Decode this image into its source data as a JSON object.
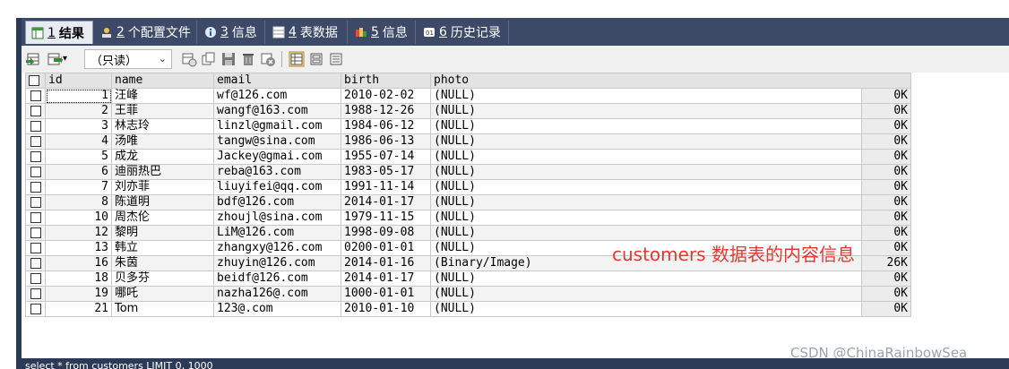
{
  "tabs": [
    {
      "num": "1",
      "label": "结果",
      "active": true,
      "icon": "result-grid-icon"
    },
    {
      "num": "2",
      "label": "个配置文件",
      "active": false,
      "icon": "profile-icon"
    },
    {
      "num": "3",
      "label": "信息",
      "active": false,
      "icon": "info-icon"
    },
    {
      "num": "4",
      "label": "表数据",
      "active": false,
      "icon": "table-data-icon"
    },
    {
      "num": "5",
      "label": "信息",
      "active": false,
      "icon": "info-color-icon"
    },
    {
      "num": "6",
      "label": "历史记录",
      "active": false,
      "icon": "history-icon"
    }
  ],
  "toolbar": {
    "mode_select": "（只读）"
  },
  "columns": [
    "id",
    "name",
    "email",
    "birth",
    "photo"
  ],
  "rows": [
    {
      "id": "1",
      "name": "汪峰",
      "email": "wf@126.com",
      "birth": "2010-02-02",
      "photo": "(NULL)",
      "size": "0K"
    },
    {
      "id": "2",
      "name": "王菲",
      "email": "wangf@163.com",
      "birth": "1988-12-26",
      "photo": "(NULL)",
      "size": "0K"
    },
    {
      "id": "3",
      "name": "林志玲",
      "email": "linzl@gmail.com",
      "birth": "1984-06-12",
      "photo": "(NULL)",
      "size": "0K"
    },
    {
      "id": "4",
      "name": "汤唯",
      "email": "tangw@sina.com",
      "birth": "1986-06-13",
      "photo": "(NULL)",
      "size": "0K"
    },
    {
      "id": "5",
      "name": "成龙",
      "email": "Jackey@gmai.com",
      "birth": "1955-07-14",
      "photo": "(NULL)",
      "size": "0K"
    },
    {
      "id": "6",
      "name": "迪丽热巴",
      "email": "reba@163.com",
      "birth": "1983-05-17",
      "photo": "(NULL)",
      "size": "0K"
    },
    {
      "id": "7",
      "name": "刘亦菲",
      "email": "liuyifei@qq.com",
      "birth": "1991-11-14",
      "photo": "(NULL)",
      "size": "0K"
    },
    {
      "id": "8",
      "name": "陈道明",
      "email": "bdf@126.com",
      "birth": "2014-01-17",
      "photo": "(NULL)",
      "size": "0K"
    },
    {
      "id": "10",
      "name": "周杰伦",
      "email": "zhoujl@sina.com",
      "birth": "1979-11-15",
      "photo": "(NULL)",
      "size": "0K"
    },
    {
      "id": "12",
      "name": "黎明",
      "email": "LiM@126.com",
      "birth": "1998-09-08",
      "photo": "(NULL)",
      "size": "0K"
    },
    {
      "id": "13",
      "name": "韩立",
      "email": "zhangxy@126.com",
      "birth": "0200-01-01",
      "photo": "(NULL)",
      "size": "0K"
    },
    {
      "id": "16",
      "name": "朱茵",
      "email": "zhuyin@126.com",
      "birth": "2014-01-16",
      "photo": "(Binary/Image)",
      "size": "26K"
    },
    {
      "id": "18",
      "name": "贝多芬",
      "email": "beidf@126.com",
      "birth": "2014-01-17",
      "photo": "(NULL)",
      "size": "0K"
    },
    {
      "id": "19",
      "name": "哪吒",
      "email": "nazha126@.com",
      "birth": "1000-01-01",
      "photo": "(NULL)",
      "size": "0K"
    },
    {
      "id": "21",
      "name": "Tom",
      "email": "123@.com",
      "birth": "2010-01-10",
      "photo": "(NULL)",
      "size": "0K"
    }
  ],
  "annotation": "customers 数据表的内容信息",
  "watermark": "CSDN @ChinaRainbowSea",
  "status": "select * from customers LIMIT 0, 1000",
  "colors": {
    "tabstrip": "#3c4a68",
    "annotation": "#e8372f",
    "id_header": "#fce6b4"
  }
}
